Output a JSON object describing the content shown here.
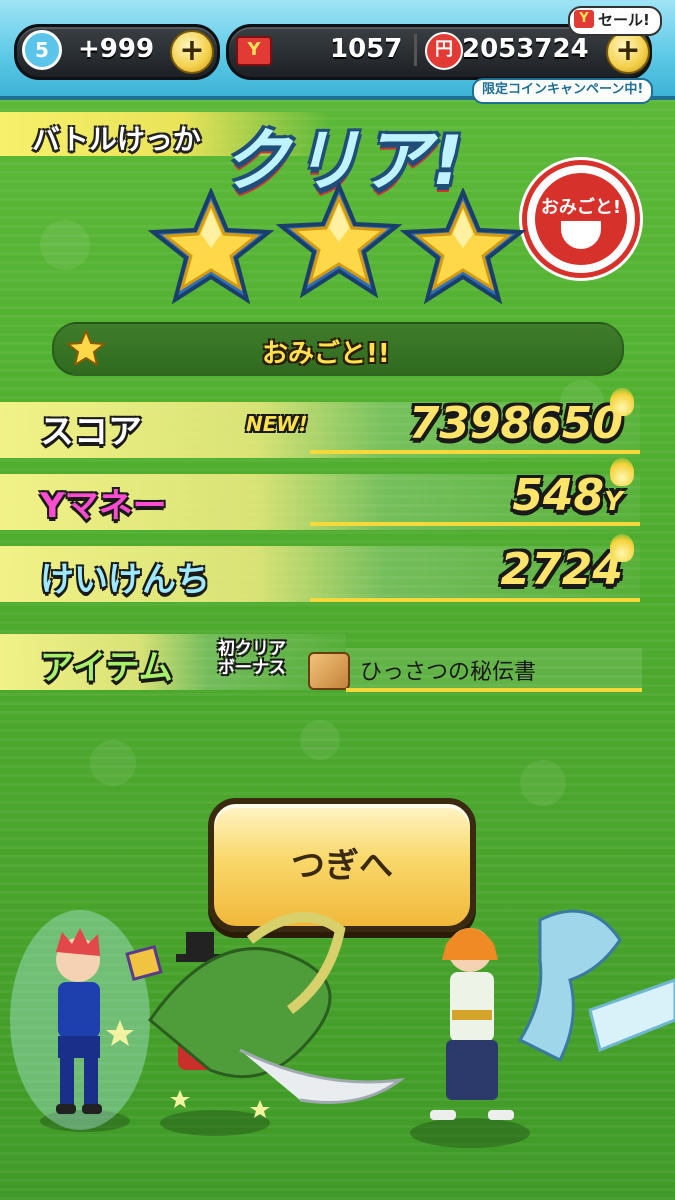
{
  "header": {
    "level": "5",
    "stamina": "+999",
    "tickets": "1057",
    "money": "2053724",
    "sale_label": "セール!",
    "campaign_label": "限定コインキャンペーン中!"
  },
  "result": {
    "battle_label": "バトルけっか",
    "clear_label": "クリア!",
    "stamp_label": "おみごと!",
    "stars_earned": 3,
    "praise_text": "おみごと!!"
  },
  "rows": {
    "score_label": "スコア",
    "new_badge": "NEW!",
    "score_value": "7398650",
    "money_label": "Yマネー",
    "money_value": "548",
    "money_unit": "Y",
    "exp_label": "けいけんち",
    "exp_value": "2724",
    "item_label": "アイテム",
    "item_bonus_line1": "初クリア",
    "item_bonus_line2": "ボーナス",
    "item_name": "ひっさつの秘伝書"
  },
  "actions": {
    "next_label": "つぎへ"
  },
  "colors": {
    "background": "#4fae2f",
    "accent_yellow": "#ffe46b",
    "button": "#f9d86b",
    "topbar": "#5bc8e6"
  }
}
